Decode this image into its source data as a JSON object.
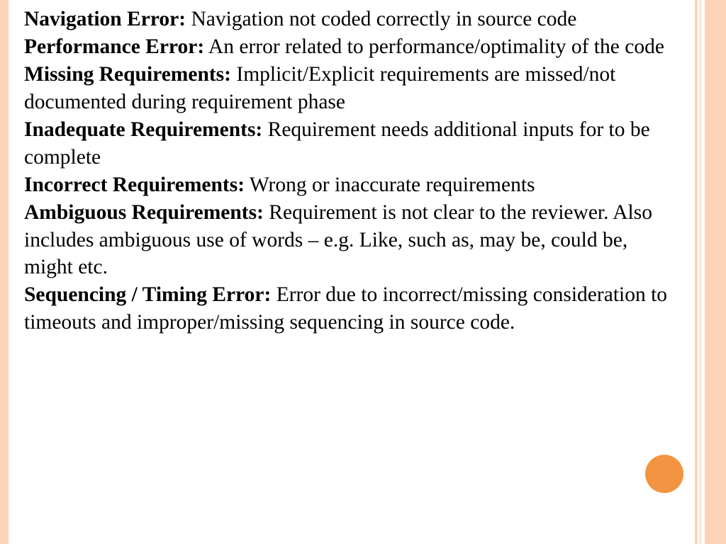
{
  "colors": {
    "stripe": "#fbd4b7",
    "stripe_light": "#ffe7d6",
    "bullet": "#f39442"
  },
  "definitions": [
    {
      "term": "Navigation Error:",
      "desc": " Navigation not coded correctly in source code"
    },
    {
      "term": "Performance Error:",
      "desc": " An error related to performance/optimality of the code"
    },
    {
      "term": "Missing Requirements:",
      "desc": " Implicit/Explicit requirements are missed/not documented during requirement phase"
    },
    {
      "term": "Inadequate Requirements:",
      "desc": " Requirement needs additional inputs for to be complete"
    },
    {
      "term": "Incorrect Requirements:",
      "desc": " Wrong or inaccurate requirements"
    },
    {
      "term": "Ambiguous Requirements:",
      "desc": " Requirement is not clear to the reviewer. Also includes ambiguous use of words – e.g. Like, such as, may be, could be, might etc."
    },
    {
      "term": "Sequencing / Timing Error:",
      "desc": " Error due to incorrect/missing consideration to timeouts and improper/missing sequencing in source code."
    }
  ]
}
